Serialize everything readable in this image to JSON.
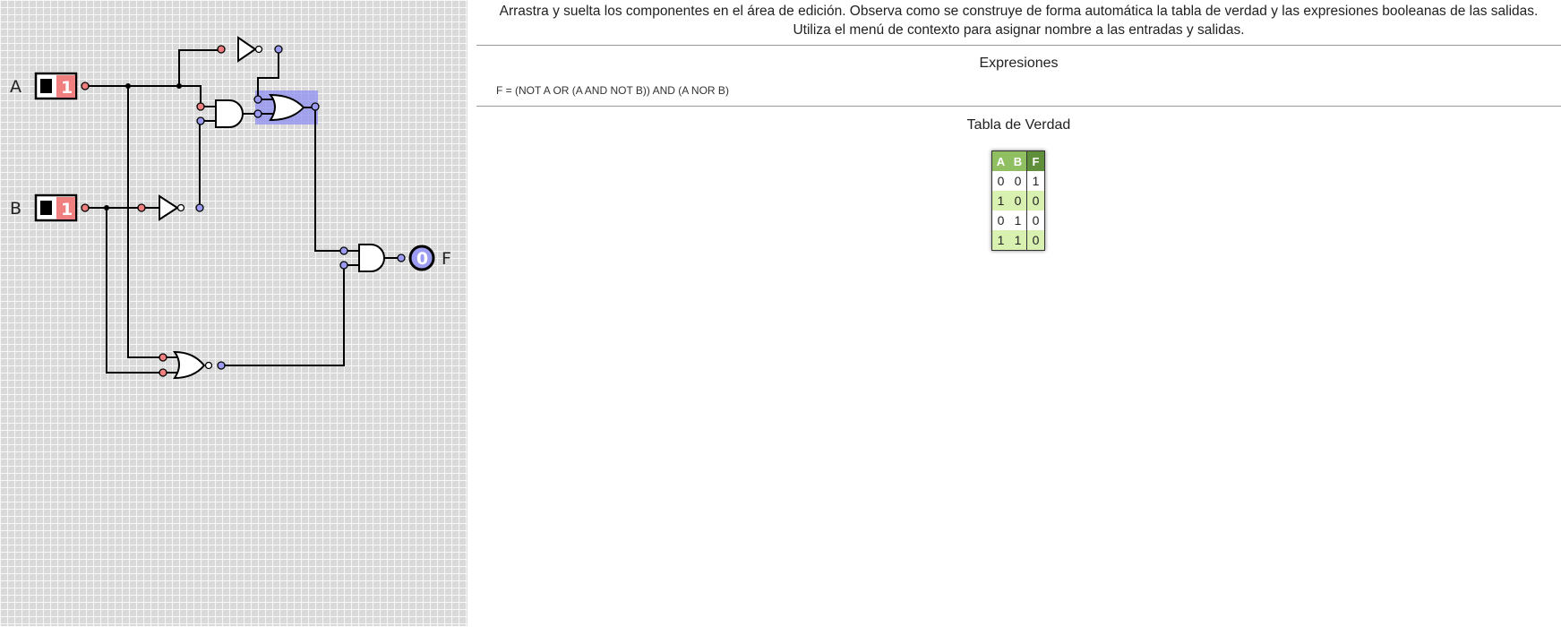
{
  "instructions": {
    "line1": "Arrastra y suelta los componentes en el área de edición. Observa como se construye de forma automática la tabla de verdad y las expresiones booleanas de las salidas.",
    "line2": "Utiliza el menú de contexto para asignar nombre a las entradas y salidas."
  },
  "expressions": {
    "heading": "Expresiones",
    "items": [
      "F = (NOT A OR (A AND NOT B)) AND (A NOR B)"
    ]
  },
  "truth_table": {
    "heading": "Tabla de Verdad",
    "inputs": [
      "A",
      "B"
    ],
    "outputs": [
      "F"
    ],
    "rows": [
      [
        "0",
        "0",
        "1"
      ],
      [
        "1",
        "0",
        "0"
      ],
      [
        "0",
        "1",
        "0"
      ],
      [
        "1",
        "1",
        "0"
      ]
    ]
  },
  "circuit": {
    "inputs": [
      {
        "name": "A",
        "state": "1"
      },
      {
        "name": "B",
        "state": "1"
      }
    ],
    "output": {
      "name": "F",
      "state": "0"
    },
    "colors": {
      "high": "#f08080",
      "low": "#9c9cf2",
      "selection": "#8c8cf0",
      "grid_bg": "#d9d9d9"
    }
  }
}
